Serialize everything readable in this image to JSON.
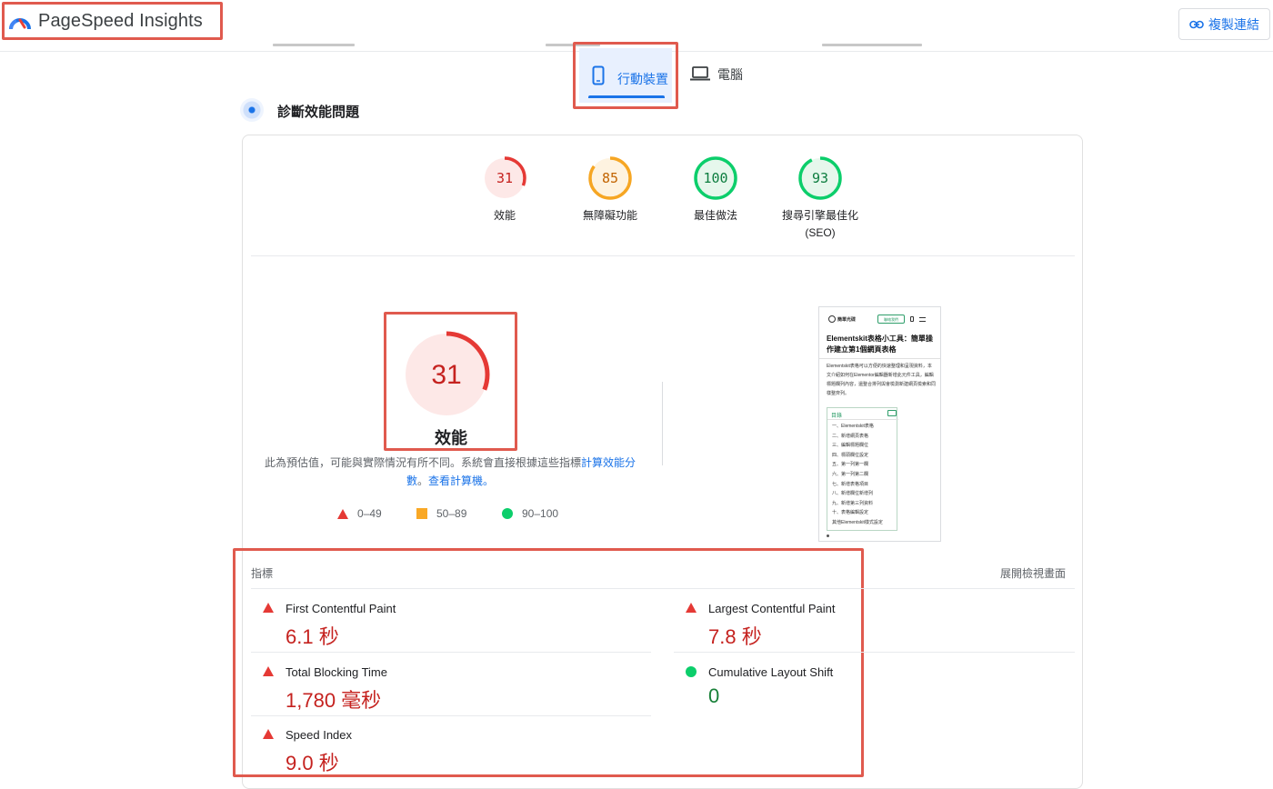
{
  "header": {
    "app_title": "PageSpeed Insights",
    "copy_link_label": "複製連結"
  },
  "device_tabs": {
    "mobile_label": "行動裝置",
    "desktop_label": "電腦",
    "active": "mobile"
  },
  "section": {
    "title": "診斷效能問題"
  },
  "scores": [
    {
      "value": 31,
      "label": "效能",
      "sublabel": "",
      "status": "fail"
    },
    {
      "value": 85,
      "label": "無障礙功能",
      "sublabel": "",
      "status": "average"
    },
    {
      "value": 100,
      "label": "最佳做法",
      "sublabel": "",
      "status": "pass"
    },
    {
      "value": 93,
      "label": "搜尋引擎最佳化",
      "sublabel": "(SEO)",
      "status": "pass"
    }
  ],
  "performance": {
    "score": 31,
    "label": "效能",
    "note_text": "此為預估值，可能與實際情況有所不同。系統會直接根據這些指標",
    "note_link1": "計算效能分數",
    "note_sep": "。",
    "note_link2": "查看計算機",
    "note_end": "。"
  },
  "legend": [
    {
      "range": "0–49",
      "shape": "triangle",
      "color": "#e53935"
    },
    {
      "range": "50–89",
      "shape": "square",
      "color": "#f9a825"
    },
    {
      "range": "90–100",
      "shape": "circle",
      "color": "#0cce6b"
    }
  ],
  "thumbnail": {
    "site_name": "簡單光碟",
    "button_text": "聯絡我們",
    "heading": "Elementskit表格小工具：簡單操作建立第1個網頁表格",
    "body": "Elementskit表格可以方便的快速整理和呈現資料，本文介紹如何在Elementor編輯器新增此元件工具，編輯標題欄列內容，還整合排列與會檢測新建網頁檢索和同樣整齊列。",
    "toc_title": "目錄",
    "toc_items": [
      "一、Elementskit表格",
      "二、新增網頁表格",
      "三、編輯標題欄位",
      "四、標頭欄位設定",
      "五、第一列第一欄",
      "六、第一列第二欄",
      "七、新增表格項目",
      "八、新增欄位新增列",
      "九、新增第三列資料",
      "十、表格編輯設定",
      "其他Elementskit樣式設定"
    ]
  },
  "metrics": {
    "heading": "指標",
    "expand_label": "展開檢視畫面",
    "items": [
      {
        "name": "First Contentful Paint",
        "value": "6.1 秒",
        "status": "fail"
      },
      {
        "name": "Largest Contentful Paint",
        "value": "7.8 秒",
        "status": "fail"
      },
      {
        "name": "Total Blocking Time",
        "value": "1,780 毫秒",
        "status": "fail"
      },
      {
        "name": "Cumulative Layout Shift",
        "value": "0",
        "status": "pass"
      },
      {
        "name": "Speed Index",
        "value": "9.0 秒",
        "status": "fail"
      }
    ]
  },
  "colors": {
    "fail": "#e53935",
    "fail_bg": "#fde8e7",
    "average": "#f6a623",
    "average_bg": "#fef3e0",
    "pass": "#0cce6b",
    "pass_bg": "#e6f7ec",
    "accent": "#1a73e8",
    "highlight_border": "#e05a4e"
  }
}
